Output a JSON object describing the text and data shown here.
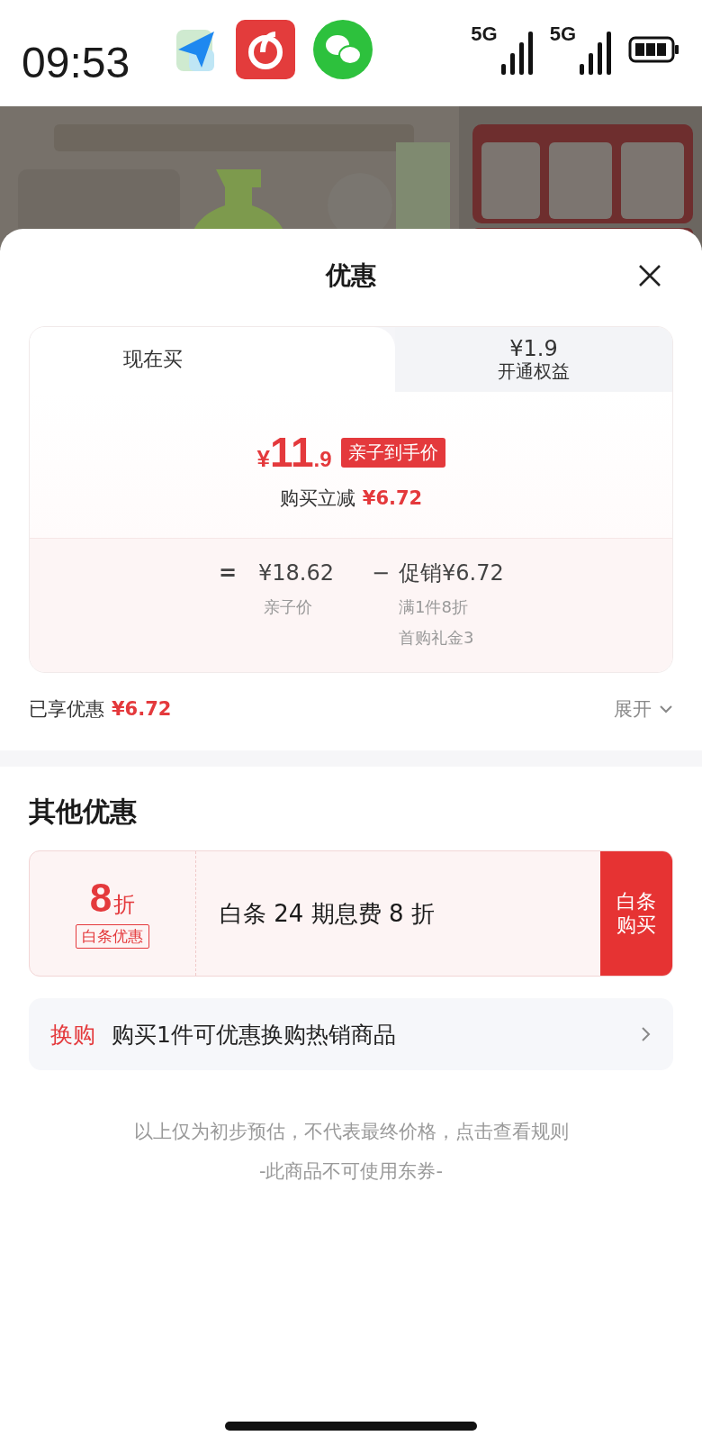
{
  "status_bar": {
    "time": "09:53",
    "network_labels": [
      "5G",
      "5G"
    ]
  },
  "sheet": {
    "title": "优惠"
  },
  "tabs": [
    {
      "label": "现在买",
      "selected": true
    },
    {
      "price": "¥1.9",
      "label": "开通权益",
      "selected": false
    }
  ],
  "price_panel": {
    "currency": "¥",
    "price_int": "11",
    "price_dec": ".9",
    "price_tag": "亲子到手价",
    "reduction_label": "购买立减",
    "reduction_value": "¥6.72",
    "equation": {
      "equals": "=",
      "base": "¥18.62",
      "base_label": "亲子价",
      "minus": "−",
      "promo": "促销¥6.72",
      "promo_details": [
        "满1件8折",
        "首购礼金3"
      ]
    }
  },
  "saved": {
    "label": "已享优惠",
    "value": "¥6.72",
    "expand": "展开"
  },
  "other_offers": {
    "title": "其他优惠",
    "coupon": {
      "discount_num": "8",
      "discount_unit": "折",
      "tag": "白条优惠",
      "description": "白条 24 期息费 8 折",
      "action": "白条购买"
    },
    "exchange": {
      "tag": "换购",
      "text": "购买1件可优惠换购热销商品"
    }
  },
  "footer": {
    "notes": [
      "以上仅为初步预估，不代表最终价格，点击查看规则",
      "-此商品不可使用东券-"
    ]
  }
}
